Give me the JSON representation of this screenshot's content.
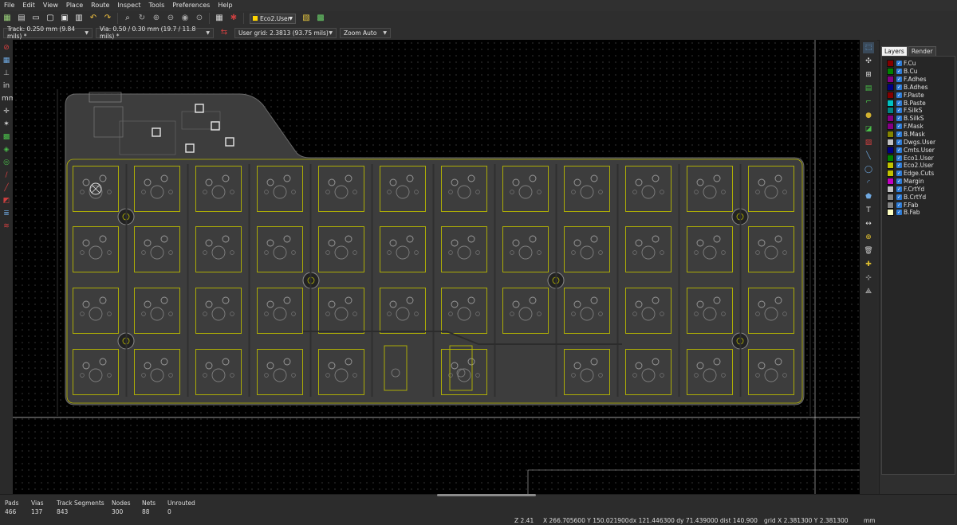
{
  "menu": [
    "File",
    "Edit",
    "View",
    "Place",
    "Route",
    "Inspect",
    "Tools",
    "Preferences",
    "Help"
  ],
  "toolbar": {
    "layer_select": "Eco2.User",
    "icons": [
      "new-board-icon",
      "open-icon",
      "save-icon",
      "page-setup-icon",
      "print-icon",
      "plot-icon",
      "undo-icon",
      "redo-icon",
      "find-icon",
      "refresh-icon",
      "zoom-in-icon",
      "zoom-out-icon",
      "zoom-fit-icon",
      "zoom-area-icon",
      "netlist-icon",
      "drc-icon",
      "layer-pair-icon",
      "footprint-editor-icon",
      "autoroute-icon",
      "scripting-icon"
    ]
  },
  "options": {
    "track": "Track: 0.250 mm (9.84 mils) *",
    "via": "Via: 0.50 / 0.30 mm (19.7 / 11.8 mils) *",
    "grid": "User grid: 2.3813 (93.75 mils)",
    "zoom": "Zoom Auto"
  },
  "layer_manager": {
    "tabs": [
      "Layers",
      "Render"
    ],
    "layers": [
      {
        "name": "F.Cu",
        "color": "#840000"
      },
      {
        "name": "B.Cu",
        "color": "#008400"
      },
      {
        "name": "F.Adhes",
        "color": "#840084"
      },
      {
        "name": "B.Adhes",
        "color": "#000084"
      },
      {
        "name": "F.Paste",
        "color": "#840000"
      },
      {
        "name": "B.Paste",
        "color": "#00c2c2"
      },
      {
        "name": "F.SilkS",
        "color": "#008484"
      },
      {
        "name": "B.SilkS",
        "color": "#840084"
      },
      {
        "name": "F.Mask",
        "color": "#840084"
      },
      {
        "name": "B.Mask",
        "color": "#848400"
      },
      {
        "name": "Dwgs.User",
        "color": "#c2c2c2"
      },
      {
        "name": "Cmts.User",
        "color": "#000084"
      },
      {
        "name": "Eco1.User",
        "color": "#008400"
      },
      {
        "name": "Eco2.User",
        "color": "#c2c200"
      },
      {
        "name": "Edge.Cuts",
        "color": "#c2c200"
      },
      {
        "name": "Margin",
        "color": "#c200c2"
      },
      {
        "name": "F.CrtYd",
        "color": "#c2c2c2"
      },
      {
        "name": "B.CrtYd",
        "color": "#848484"
      },
      {
        "name": "F.Fab",
        "color": "#848484"
      },
      {
        "name": "B.Fab",
        "color": "#ffffc2"
      }
    ]
  },
  "status": {
    "pads_label": "Pads",
    "pads": "466",
    "vias_label": "Vias",
    "vias": "137",
    "tracks_label": "Track Segments",
    "tracks": "843",
    "nodes_label": "Nodes",
    "nodes": "300",
    "nets_label": "Nets",
    "nets": "88",
    "unrouted_label": "Unrouted",
    "unrouted": "0",
    "zoom": "Z 2.41",
    "xy": "X 266.705600  Y 150.021900",
    "dxy": "dx 121.446300  dy 71.439000  dist 140.900",
    "grid": "grid X 2.381300  Y 2.381300",
    "units": "mm"
  },
  "colors": {
    "board": "#3d3d3d",
    "board_edge": "#6a6a6a",
    "footprint": "#b8b800",
    "accent_layer": "#ffd400"
  }
}
